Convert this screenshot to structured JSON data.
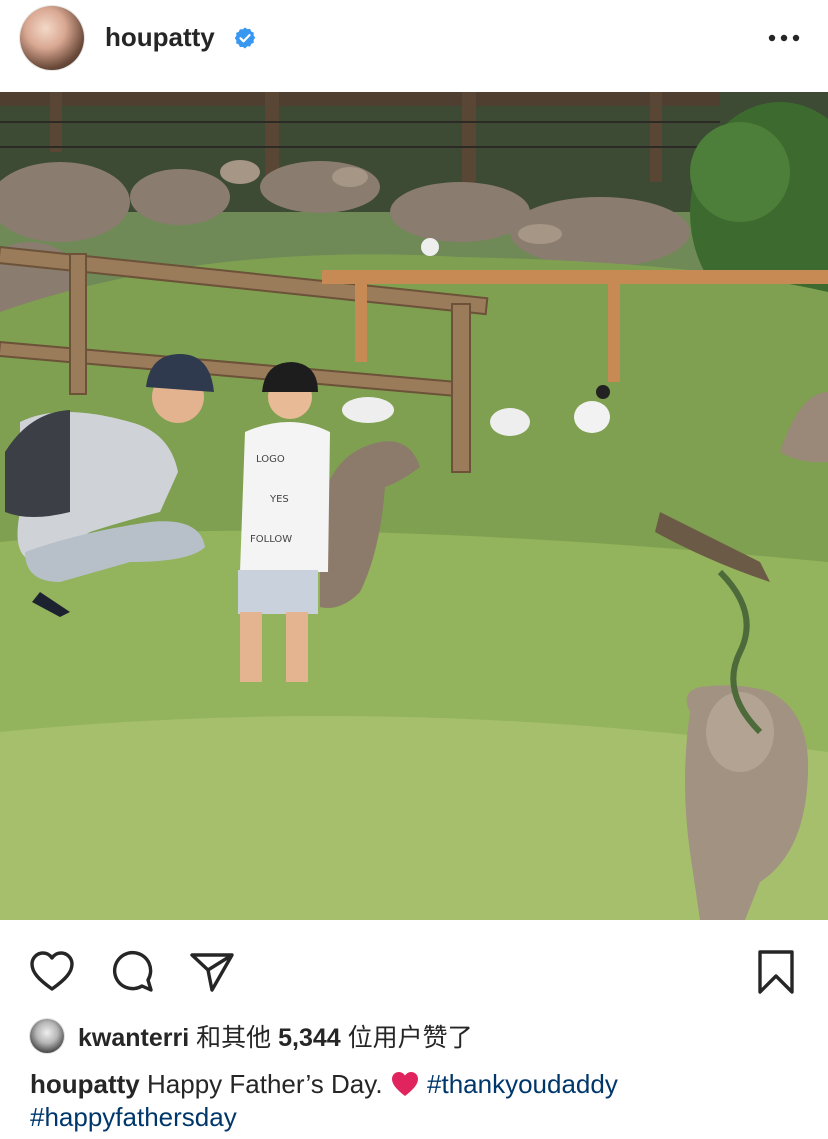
{
  "header": {
    "username": "houpatty",
    "verified_icon": "verified-badge-icon",
    "more_icon": "more-horizontal-icon"
  },
  "post": {
    "actions": {
      "like_icon": "heart-outline-icon",
      "comment_icon": "comment-icon",
      "share_icon": "send-icon",
      "save_icon": "bookmark-icon"
    },
    "likes": {
      "first_liker": "kwanterri",
      "text": "和其他",
      "count": "5,344",
      "suffix": "位用户赞了"
    },
    "caption": {
      "username": "houpatty",
      "text": "Happy Father’s Day.",
      "emoji": "red-heart-emoji",
      "hashtag_1": "#thankyoudaddy",
      "hashtag_2": "#happyfathersday"
    }
  },
  "colors": {
    "verified": "#3897f0",
    "hashtag": "#00376b",
    "text": "#262626",
    "heart_emoji": "#e0245e"
  }
}
